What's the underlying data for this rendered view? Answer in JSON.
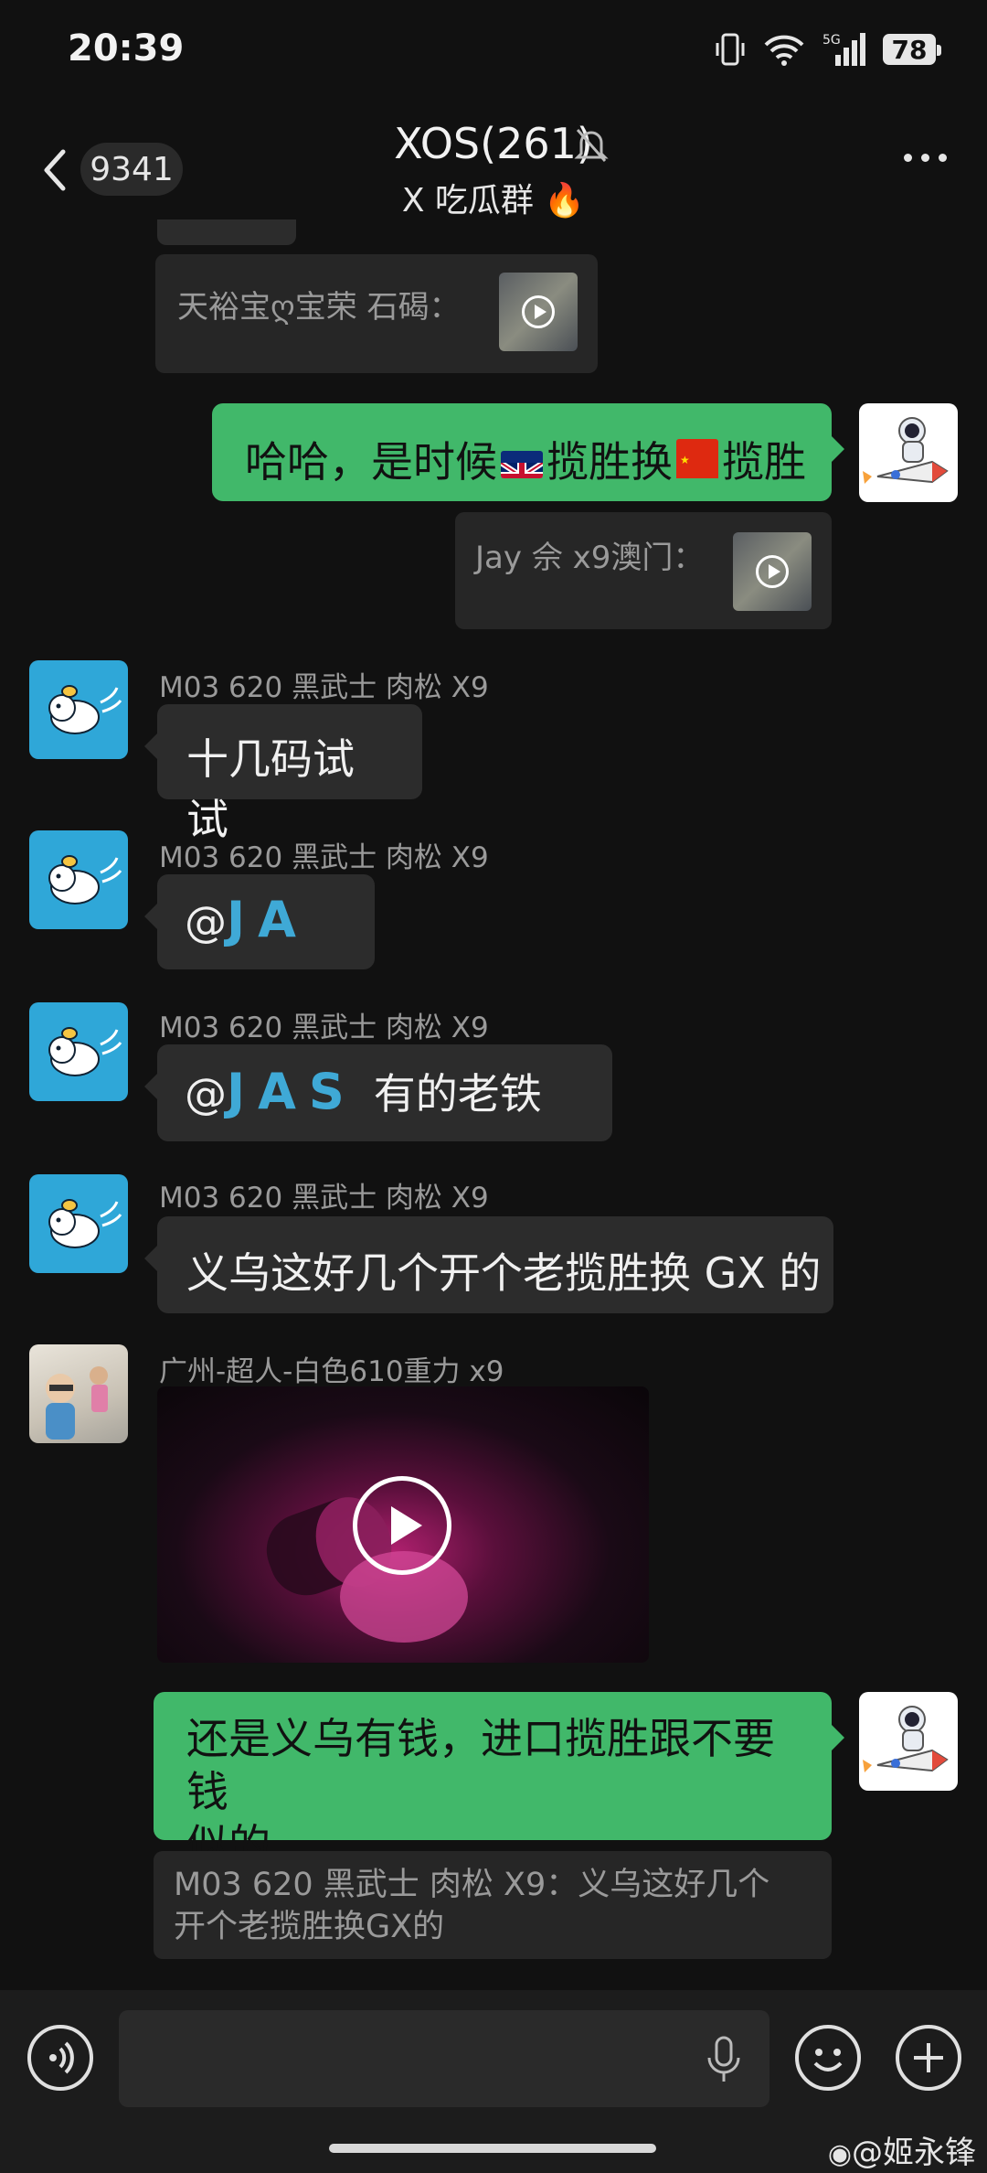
{
  "status": {
    "time": "20:39",
    "battery": "78",
    "network": "5G"
  },
  "header": {
    "back_count": "9341",
    "title": "XOS(261)",
    "subtitle": "X 吃瓜群 🔥"
  },
  "messages": {
    "q1": {
      "text": "天裕宝ღ宝荣 石碣："
    },
    "m1": {
      "text_a": "哈哈，是时候",
      "text_b": "揽胜换",
      "text_c": "揽胜"
    },
    "q2": {
      "text": "Jay 佘 x9澳门："
    },
    "m2": {
      "sender": "M03 620 黑武士 肉松 X9",
      "text": "十几码试试"
    },
    "m3": {
      "sender": "M03 620 黑武士 肉松 X9",
      "at": "@",
      "mention": "JA"
    },
    "m4": {
      "sender": "M03 620 黑武士 肉松 X9",
      "at": "@",
      "mention": "JAS",
      "text": "有的老铁"
    },
    "m5": {
      "sender": "M03 620 黑武士 肉松 X9",
      "text": "义乌这好几个开个老揽胜换 GX 的"
    },
    "m6": {
      "sender": "广州-超人-白色610重力 x9"
    },
    "m7": {
      "line1": "还是义乌有钱，进口揽胜跟不要钱",
      "line2": "似的"
    },
    "q3": {
      "line1": "M03 620 黑武士 肉松 X9：义乌这好几个",
      "line2": "开个老揽胜换GX的"
    }
  },
  "input": {
    "placeholder": ""
  },
  "watermark": "@姬永锋",
  "colors": {
    "bg": "#111111",
    "bubble_gray": "#2c2c2c",
    "bubble_green": "#41b86a",
    "mention": "#3fa9d6"
  }
}
